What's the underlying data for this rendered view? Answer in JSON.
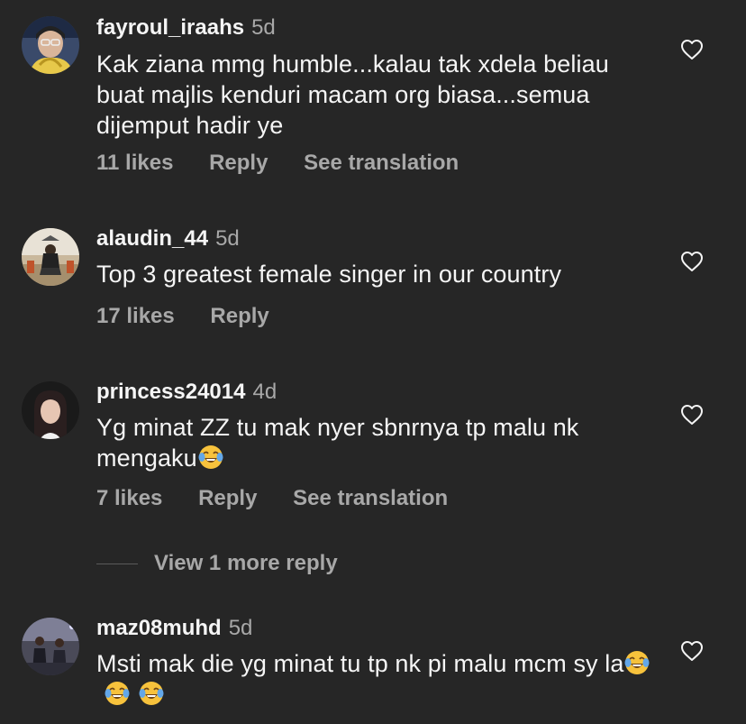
{
  "comments": [
    {
      "username": "fayroul_iraahs",
      "age": "5d",
      "text": "Kak ziana mmg humble...kalau tak xdela beliau buat majlis kenduri macam org biasa...semua dijemput hadir ye",
      "emoji_count": 0,
      "likes": "11 likes",
      "reply": "Reply",
      "translate": "See translation"
    },
    {
      "username": "alaudin_44",
      "age": "5d",
      "text": "Top 3 greatest female singer in our country",
      "emoji_count": 0,
      "likes": "17 likes",
      "reply": "Reply",
      "translate": ""
    },
    {
      "username": "princess24014",
      "age": "4d",
      "text": "Yg minat ZZ tu mak nyer sbnrnya tp malu nk mengaku",
      "emoji_count": 1,
      "likes": "7 likes",
      "reply": "Reply",
      "translate": "See translation"
    },
    {
      "username": "maz08muhd",
      "age": "5d",
      "text": "Msti mak die yg minat tu tp nk pi malu mcm sy la",
      "emoji_count": 3
    }
  ],
  "view_more": "View 1 more reply",
  "icons": {
    "like": "heart-outline-icon",
    "emoji": "face-with-tears-of-joy-emoji"
  },
  "colors": {
    "background": "#262626",
    "primary_text": "#f5f5f5",
    "secondary_text": "#a8a8a8"
  }
}
